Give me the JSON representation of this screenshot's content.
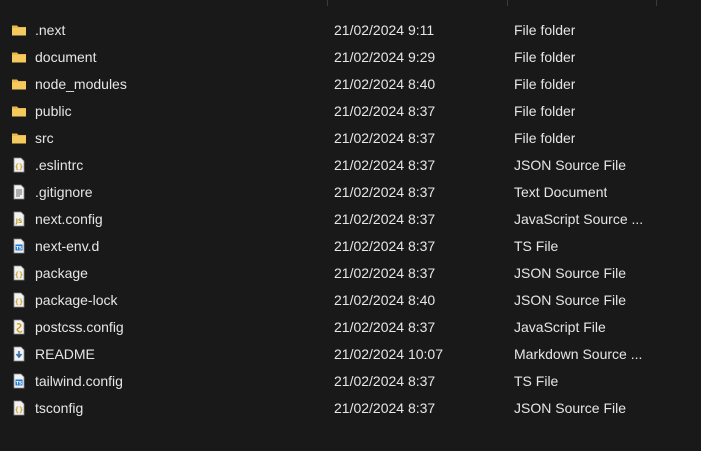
{
  "files": [
    {
      "name": ".next",
      "modified": "21/02/2024 9:11",
      "type": "File folder",
      "icon": "folder-icon"
    },
    {
      "name": "document",
      "modified": "21/02/2024 9:29",
      "type": "File folder",
      "icon": "folder-icon"
    },
    {
      "name": "node_modules",
      "modified": "21/02/2024 8:40",
      "type": "File folder",
      "icon": "folder-icon"
    },
    {
      "name": "public",
      "modified": "21/02/2024 8:37",
      "type": "File folder",
      "icon": "folder-icon"
    },
    {
      "name": "src",
      "modified": "21/02/2024 8:37",
      "type": "File folder",
      "icon": "folder-icon"
    },
    {
      "name": ".eslintrc",
      "modified": "21/02/2024 8:37",
      "type": "JSON Source File",
      "icon": "json-file-icon"
    },
    {
      "name": ".gitignore",
      "modified": "21/02/2024 8:37",
      "type": "Text Document",
      "icon": "text-file-icon"
    },
    {
      "name": "next.config",
      "modified": "21/02/2024 8:37",
      "type": "JavaScript Source ...",
      "icon": "js-file-icon"
    },
    {
      "name": "next-env.d",
      "modified": "21/02/2024 8:37",
      "type": "TS File",
      "icon": "ts-file-icon"
    },
    {
      "name": "package",
      "modified": "21/02/2024 8:37",
      "type": "JSON Source File",
      "icon": "json-file-icon"
    },
    {
      "name": "package-lock",
      "modified": "21/02/2024 8:40",
      "type": "JSON Source File",
      "icon": "json-file-icon"
    },
    {
      "name": "postcss.config",
      "modified": "21/02/2024 8:37",
      "type": "JavaScript File",
      "icon": "js-script-file-icon"
    },
    {
      "name": "README",
      "modified": "21/02/2024 10:07",
      "type": "Markdown Source ...",
      "icon": "markdown-file-icon"
    },
    {
      "name": "tailwind.config",
      "modified": "21/02/2024 8:37",
      "type": "TS File",
      "icon": "ts-file-icon"
    },
    {
      "name": "tsconfig",
      "modified": "21/02/2024 8:37",
      "type": "JSON Source File",
      "icon": "json-file-icon"
    }
  ],
  "colors": {
    "background": "#191919",
    "text": "#e6e6e6",
    "folder": "#e8b84a"
  }
}
